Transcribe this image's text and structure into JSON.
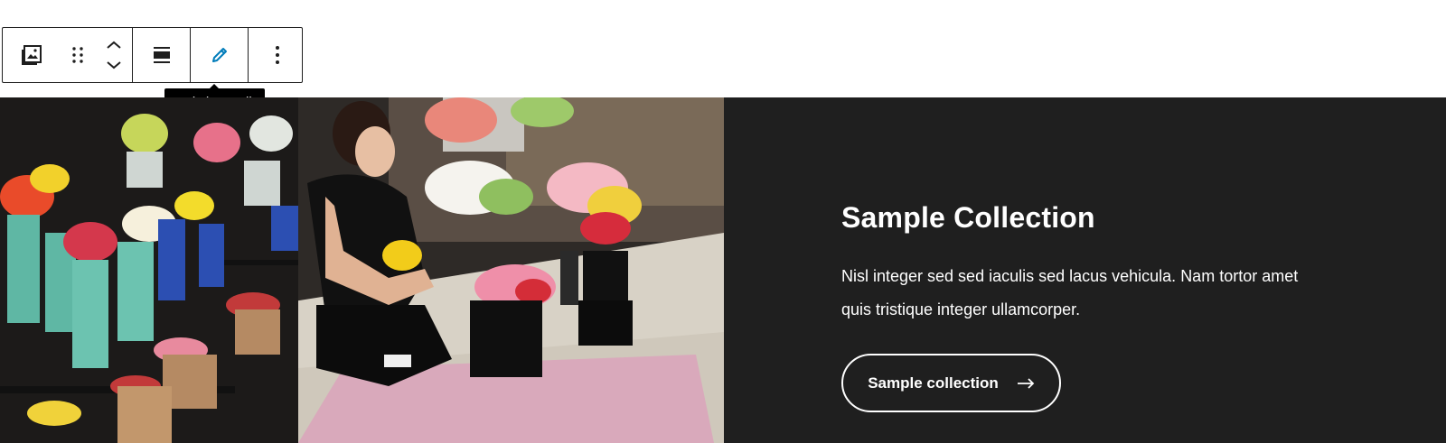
{
  "toolbar": {
    "items": [
      {
        "icon": "image-block-icon"
      },
      {
        "icon": "drag-handle-icon"
      },
      {
        "icon": "move-up-down-icon"
      },
      {
        "icon": "align-icon"
      },
      {
        "icon": "pencil-icon"
      },
      {
        "icon": "more-options-icon"
      }
    ],
    "tooltip": "Switch to Edit"
  },
  "content": {
    "title": "Sample Collection",
    "description": "Nisl integer sed sed iaculis sed lacus vehicula. Nam tortor amet quis tristique integer ullamcorper.",
    "button_label": "Sample collection",
    "button_icon": "arrow-right-icon"
  },
  "colors": {
    "panel_bg": "#1f1f1f",
    "accent": "#007cba"
  }
}
